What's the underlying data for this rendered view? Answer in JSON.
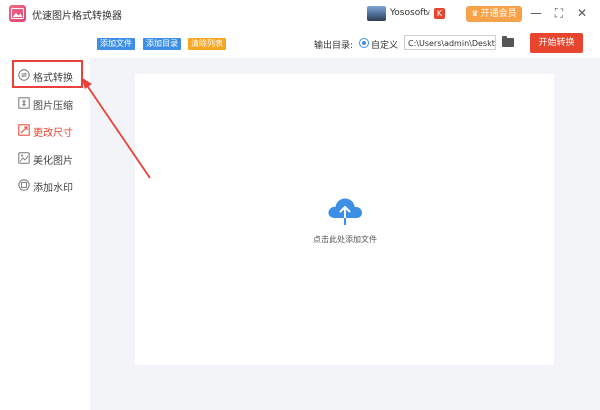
{
  "app": {
    "title": "优速图片格式转换器"
  },
  "user": {
    "name": "Yososoft",
    "chevron": "∨",
    "badge": "K"
  },
  "vip": {
    "label": "开通会员",
    "icon": "crown-icon"
  },
  "window_controls": {
    "minimize": "—",
    "restore": "⛶",
    "close": "✕"
  },
  "toolbar": {
    "add_file": "添加文件",
    "add_folder": "添加目录",
    "clear_list": "清除列表",
    "output_label": "输出目录:",
    "radio_label": "自定义",
    "output_path": "C:\\Users\\admin\\Deskto",
    "start_label": "开始转换"
  },
  "sidebar": {
    "items": [
      {
        "label": "格式转换",
        "icon": "format-convert-icon",
        "active": false
      },
      {
        "label": "图片压缩",
        "icon": "compress-icon",
        "active": false
      },
      {
        "label": "更改尺寸",
        "icon": "resize-icon",
        "active": true
      },
      {
        "label": "美化图片",
        "icon": "beautify-icon",
        "active": false
      },
      {
        "label": "添加水印",
        "icon": "watermark-icon",
        "active": false
      }
    ]
  },
  "dropzone": {
    "text": "点击此处添加文件",
    "icon": "cloud-upload-icon"
  },
  "colors": {
    "accent_blue": "#3d8fe6",
    "accent_red": "#e8452e",
    "orange": "#f5a623",
    "annotation_red": "#e8423a"
  }
}
